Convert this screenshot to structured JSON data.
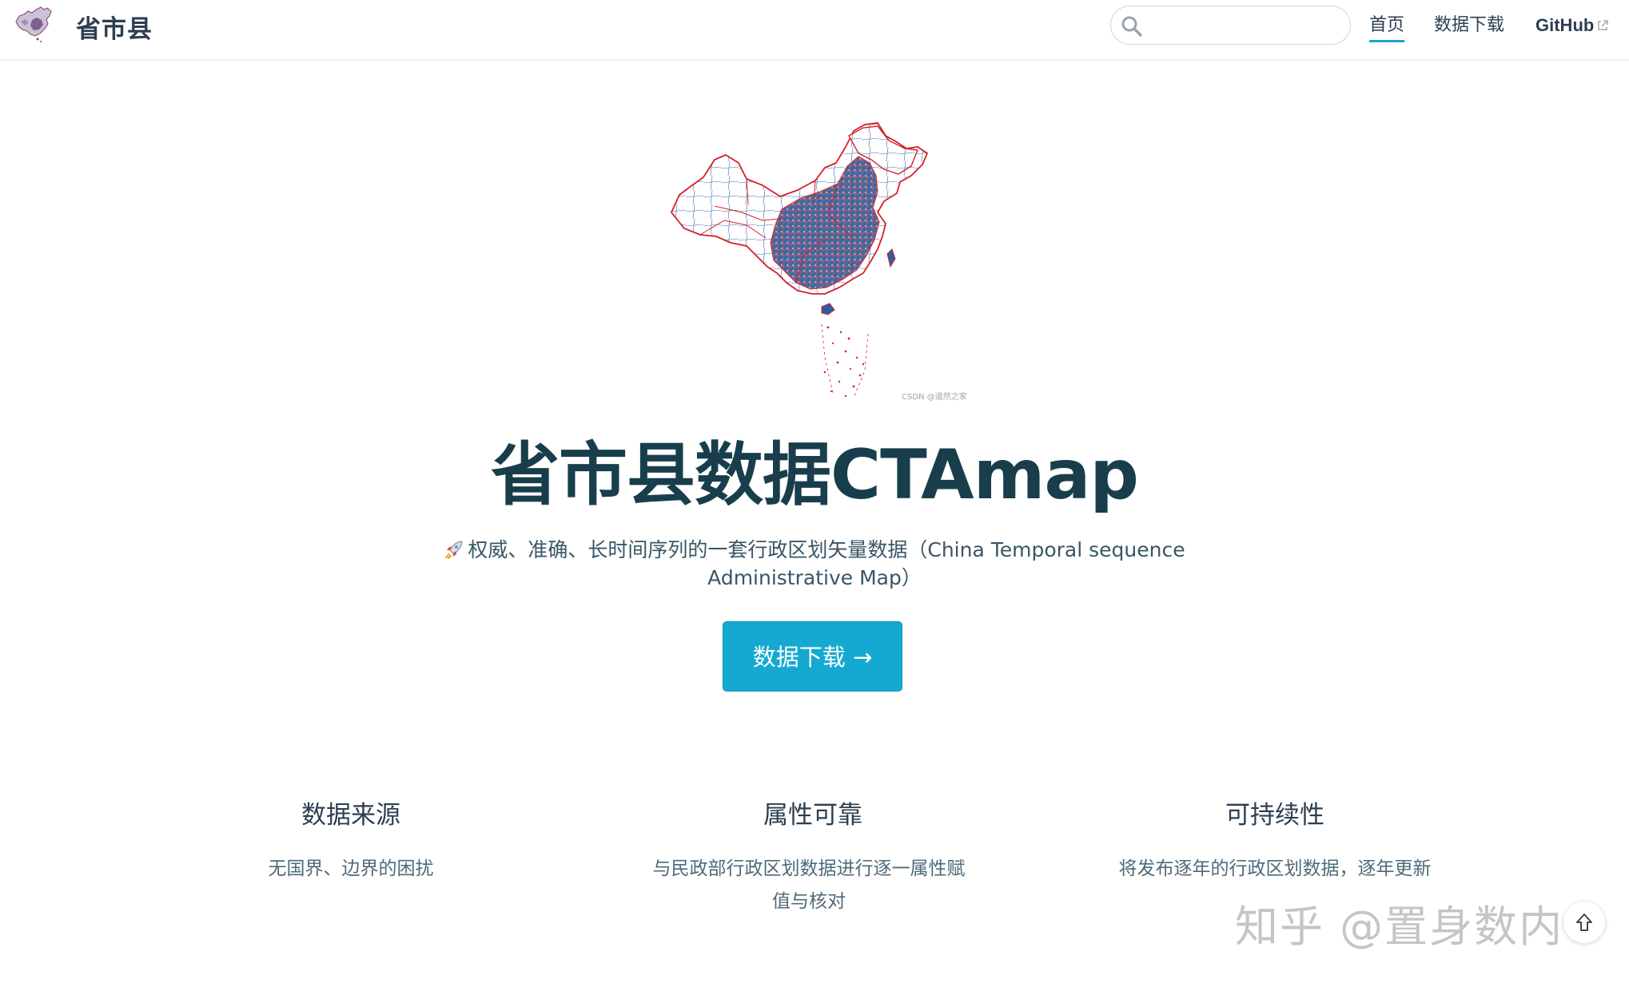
{
  "navbar": {
    "brand_title": "省市县",
    "search": {
      "value": "",
      "placeholder": ""
    },
    "links": {
      "home": "首页",
      "download": "数据下载",
      "github": "GitHub"
    }
  },
  "hero": {
    "image_caption": "CSDN @道然之家",
    "title": "省市县数据CTAmap",
    "description_line1": "权威、准确、长时间序列的一套行政区划矢量数据（China Temporal sequence",
    "description_line2": "Administrative Map）",
    "cta_label": "数据下载 →"
  },
  "features": [
    {
      "title": "数据来源",
      "text": "无国界、边界的困扰"
    },
    {
      "title": "属性可靠",
      "text": "与民政部行政区划数据进行逐一属性赋值与核对"
    },
    {
      "title": "可持续性",
      "text": "将发布逐年的行政区划数据，逐年更新"
    }
  ],
  "overlays": {
    "watermark": "知乎 @置身数内"
  },
  "icons": {
    "brand": "china-map-logo-icon",
    "search": "search-icon",
    "external": "external-link-icon",
    "rocket": "rocket-icon",
    "back_to_top": "arrow-up-icon"
  },
  "colors": {
    "accent": "#15a9d1",
    "title": "#183e4c",
    "text": "#2c3e50",
    "map_border": "#d3202a",
    "map_fill": "#1d4c8a"
  }
}
